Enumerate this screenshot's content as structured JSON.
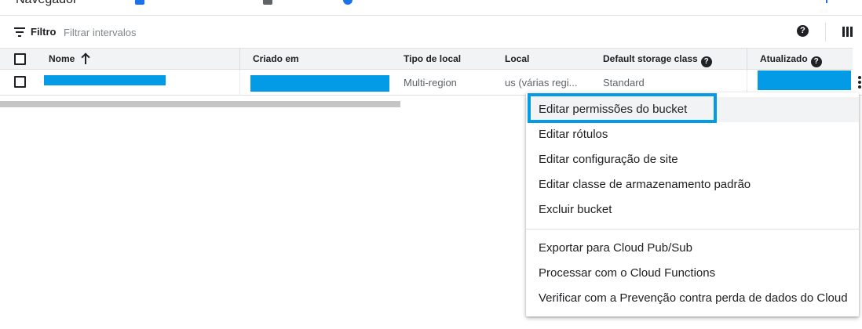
{
  "header": {
    "title": "Navegador"
  },
  "filter_bar": {
    "label": "Filtro",
    "placeholder": "Filtrar intervalos",
    "icons": [
      "filter-list-icon",
      "help-icon",
      "column-display-icon"
    ]
  },
  "table": {
    "columns": [
      {
        "label": "Nome",
        "sort": "ascending",
        "icon": "arrow-up-icon"
      },
      {
        "label": "Criado em"
      },
      {
        "label": "Tipo de local"
      },
      {
        "label": "Local"
      },
      {
        "label": "Default storage class",
        "icon": "help-icon"
      },
      {
        "label": "Atualizado",
        "icon": "help-icon"
      }
    ],
    "rows": [
      {
        "location_type": "Multi-region",
        "location": "us (várias regi...",
        "storage_class": "Standard"
      }
    ]
  },
  "context_menu": {
    "items": [
      "Editar permissões do bucket",
      "Editar rótulos",
      "Editar configuração de site",
      "Editar classe de armazenamento padrão",
      "Excluir bucket",
      "Exportar para Cloud Pub/Sub",
      "Processar com o Cloud Functions",
      "Verificar com a Prevenção contra perda de dados do Cloud"
    ],
    "highlighted_index": 0,
    "highlight_color": "#039be5"
  },
  "colors": {
    "redaction": "#039be5",
    "header_bg": "#f1f3f4",
    "text_primary": "#202124",
    "text_secondary": "#5f6368"
  }
}
